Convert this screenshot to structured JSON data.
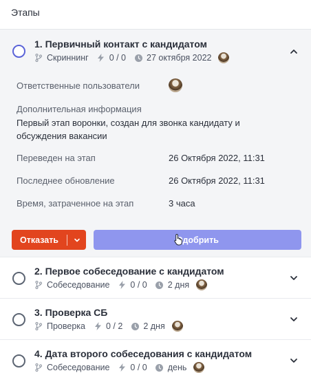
{
  "section_title": "Этапы",
  "stages": [
    {
      "title": "1. Первичный контакт с кандидатом",
      "type": "Скриннинг",
      "count": "0 / 0",
      "time": "27 октября 2022",
      "details": {
        "responsible_label": "Ответственные пользователи",
        "info_label": "Дополнительная информация",
        "info_text": "Первый этап воронки, создан для звонка кандидату и обсуждения вакансии",
        "moved_label": "Переведен на этап",
        "moved_value": "26 Октября 2022, 11:31",
        "updated_label": "Последнее обновление",
        "updated_value": "26 Октября 2022, 11:31",
        "spent_label": "Время, затраченное на этап",
        "spent_value": "3 часа"
      },
      "reject_label": "Отказать",
      "approve_label": "Одобрить"
    },
    {
      "title": "2. Первое собеседование с кандидатом",
      "type": "Собеседование",
      "count": "0 / 0",
      "time": "2 дня"
    },
    {
      "title": "3. Проверка СБ",
      "type": "Проверка",
      "count": "0 / 2",
      "time": "2 дня"
    },
    {
      "title": "4. Дата второго собеседования с кандидатом",
      "type": "Собеседование",
      "count": "0 / 0",
      "time": "день"
    }
  ],
  "colors": {
    "accent": "#5a63d8",
    "reject": "#e2451e",
    "approve": "#8f96ee",
    "expanded_bg": "#f4f5f7"
  }
}
